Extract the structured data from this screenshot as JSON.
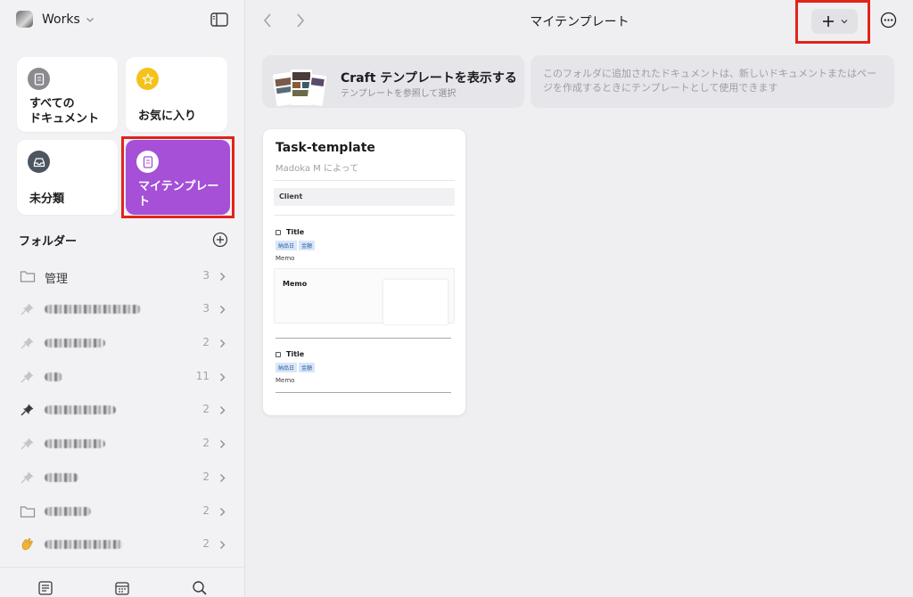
{
  "workspace": {
    "name": "Works"
  },
  "smart_folders": [
    {
      "label": "すべての\nドキュメント",
      "icon": "document-icon"
    },
    {
      "label": "お気に入り",
      "icon": "star-icon"
    },
    {
      "label": "未分類",
      "icon": "inbox-icon"
    },
    {
      "label": "マイテンプレート",
      "icon": "template-icon",
      "selected": true
    }
  ],
  "folders": {
    "heading": "フォルダー",
    "items": [
      {
        "name": "管理",
        "count": "3",
        "icon": "folder-icon"
      },
      {
        "name": "",
        "count": "3",
        "icon": "pin-icon",
        "obscured": true
      },
      {
        "name": "",
        "count": "2",
        "icon": "pin-icon",
        "obscured": true
      },
      {
        "name": "",
        "count": "11",
        "icon": "pin-icon",
        "obscured": true
      },
      {
        "name": "",
        "count": "2",
        "icon": "pin-icon",
        "obscured": true
      },
      {
        "name": "",
        "count": "2",
        "icon": "pin-icon",
        "obscured": true
      },
      {
        "name": "",
        "count": "2",
        "icon": "pin-icon",
        "obscured": true
      },
      {
        "name": "",
        "count": "2",
        "icon": "folder-icon",
        "obscured": true
      },
      {
        "name": "",
        "count": "2",
        "icon": "waving-hand-icon",
        "obscured": true
      }
    ]
  },
  "header": {
    "title": "マイテンプレート"
  },
  "banner": {
    "title": "Craft テンプレートを表示する",
    "subtitle": "テンプレートを参照して選択"
  },
  "info": {
    "text": "このフォルダに追加されたドキュメントは、新しいドキュメントまたはページを作成するときにテンプレートとして使用できます"
  },
  "template_card": {
    "title": "Task-template",
    "author": "Madoka M によって",
    "client_label": "Client",
    "task1": {
      "title": "Title",
      "tags": [
        "納品日",
        "金額"
      ],
      "memo": "Memo"
    },
    "memo_box_title": "Memo",
    "task2": {
      "title": "Title",
      "tags": [
        "納品日",
        "金額"
      ],
      "memo": "Memo"
    }
  },
  "colors": {
    "accent": "#a550d6",
    "highlight": "#e2231a",
    "star": "#f4c21b"
  }
}
